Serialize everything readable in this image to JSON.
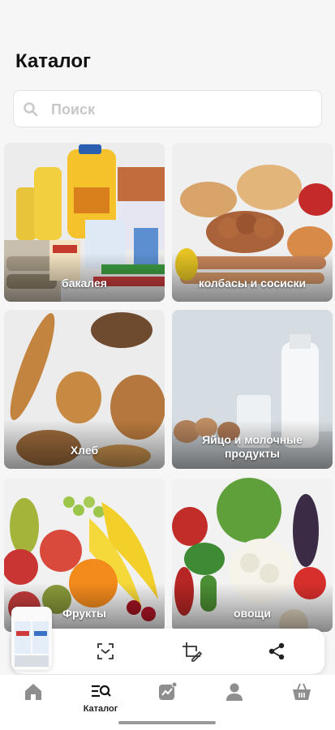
{
  "header": {
    "title": "Каталог"
  },
  "search": {
    "placeholder": "Поиск",
    "value": ""
  },
  "categories": [
    {
      "label": "бакалея"
    },
    {
      "label": "колбасы и сосиски"
    },
    {
      "label": "Хлеб"
    },
    {
      "label": "Яйцо и молочные продукты"
    },
    {
      "label": "Фрукты"
    },
    {
      "label": "овощи"
    }
  ],
  "bottom_nav": {
    "items": [
      {
        "icon": "home-icon",
        "label": ""
      },
      {
        "icon": "catalog-search-icon",
        "label": "Каталог"
      },
      {
        "icon": "promo-chart-icon",
        "label": ""
      },
      {
        "icon": "profile-icon",
        "label": ""
      },
      {
        "icon": "basket-icon",
        "label": ""
      }
    ]
  },
  "toolbar": {
    "icons": [
      "scan-icon",
      "crop-edit-icon",
      "share-icon"
    ]
  },
  "colors": {
    "accent": "#111111",
    "background": "#f6f6f6",
    "card_border": "#e3e3e3"
  }
}
